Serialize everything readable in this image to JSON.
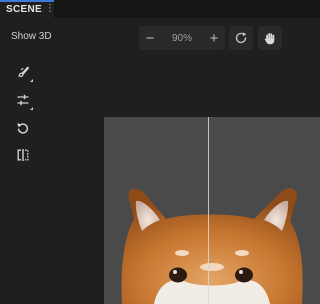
{
  "tab": {
    "label": "SCENE",
    "menu_icon": "more-vertical-icon"
  },
  "toolbar": {
    "show3d_label": "Show 3D",
    "zoom": {
      "minus_icon": "zoom-out-icon",
      "value": "90%",
      "plus_icon": "zoom-in-icon"
    },
    "reset_icon": "reset-view-icon",
    "pan_icon": "hand-pan-icon"
  },
  "tools": [
    {
      "name": "brush-icon"
    },
    {
      "name": "adjust-sliders-icon"
    },
    {
      "name": "rotate-icon"
    },
    {
      "name": "compare-split-icon"
    }
  ],
  "colors": {
    "background": "#1f1f1f",
    "accent": "#3d7bd9",
    "viewport": "#4a4a4a"
  },
  "viewport": {
    "compare_divider": true,
    "subject": "shiba-inu-dog-head"
  }
}
